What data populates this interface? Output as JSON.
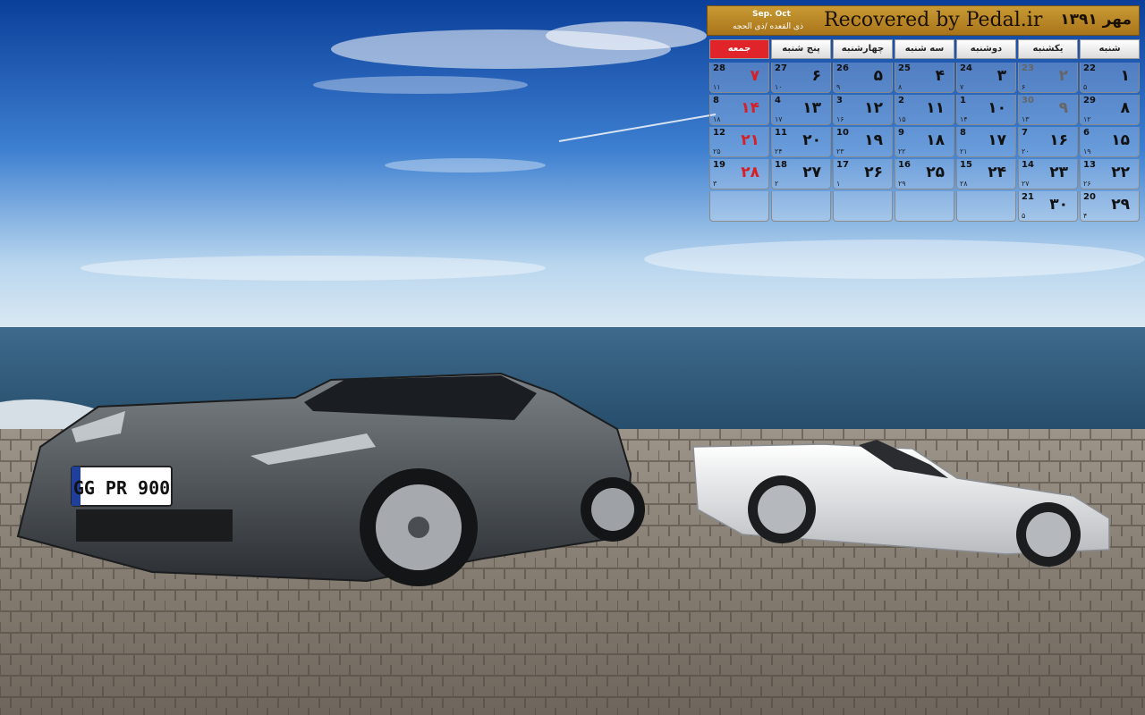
{
  "calendar": {
    "title": "Recovered by Pedal.ir",
    "month": "مهر ۱۳۹۱",
    "gregorian": "Sep. Oct",
    "hijri": "ذی القعده /ذی الحجه",
    "weekdays": [
      "شنبه",
      "یکشنبه",
      "دوشنبه",
      "سه شنبه",
      "چهارشنبه",
      "پنج شنبه",
      "جمعه"
    ],
    "weeks": [
      [
        {
          "g": "22",
          "h": "۵",
          "p": "۱"
        },
        {
          "g": "23",
          "h": "۶",
          "p": "۲"
        },
        {
          "g": "24",
          "h": "۷",
          "p": "۳"
        },
        {
          "g": "25",
          "h": "۸",
          "p": "۴"
        },
        {
          "g": "26",
          "h": "۹",
          "p": "۵"
        },
        {
          "g": "27",
          "h": "۱۰",
          "p": "۶"
        },
        {
          "g": "28",
          "h": "۱۱",
          "p": "۷"
        }
      ],
      [
        {
          "g": "29",
          "h": "۱۲",
          "p": "۸"
        },
        {
          "g": "30",
          "h": "۱۳",
          "p": "۹"
        },
        {
          "g": "1",
          "h": "۱۴",
          "p": "۱۰"
        },
        {
          "g": "2",
          "h": "۱۵",
          "p": "۱۱"
        },
        {
          "g": "3",
          "h": "۱۶",
          "p": "۱۲"
        },
        {
          "g": "4",
          "h": "۱۷",
          "p": "۱۳"
        },
        {
          "g": "8",
          "h": "۱۸",
          "p": "۱۴"
        }
      ],
      [
        {
          "g": "6",
          "h": "۱۹",
          "p": "۱۵"
        },
        {
          "g": "7",
          "h": "۲۰",
          "p": "۱۶"
        },
        {
          "g": "8",
          "h": "۲۱",
          "p": "۱۷"
        },
        {
          "g": "9",
          "h": "۲۲",
          "p": "۱۸"
        },
        {
          "g": "10",
          "h": "۲۳",
          "p": "۱۹"
        },
        {
          "g": "11",
          "h": "۲۴",
          "p": "۲۰"
        },
        {
          "g": "12",
          "h": "۲۵",
          "p": "۲۱"
        }
      ],
      [
        {
          "g": "13",
          "h": "۲۶",
          "p": "۲۲"
        },
        {
          "g": "14",
          "h": "۲۷",
          "p": "۲۳"
        },
        {
          "g": "15",
          "h": "۲۸",
          "p": "۲۴"
        },
        {
          "g": "16",
          "h": "۲۹",
          "p": "۲۵"
        },
        {
          "g": "17",
          "h": "۱",
          "p": "۲۶"
        },
        {
          "g": "18",
          "h": "۲",
          "p": "۲۷"
        },
        {
          "g": "19",
          "h": "۳",
          "p": "۲۸"
        }
      ],
      [
        {
          "g": "20",
          "h": "۴",
          "p": "۲۹"
        },
        {
          "g": "21",
          "h": "۵",
          "p": "۳۰"
        },
        {
          "g": "",
          "h": "",
          "p": ""
        },
        {
          "g": "",
          "h": "",
          "p": ""
        },
        {
          "g": "",
          "h": "",
          "p": ""
        },
        {
          "g": "",
          "h": "",
          "p": ""
        },
        {
          "g": "",
          "h": "",
          "p": ""
        }
      ]
    ]
  },
  "license_plate": "GG PR 900",
  "colors": {
    "accent_header": "#b8862a",
    "friday_red": "#e0242a",
    "sky": "#1f5fb0",
    "sea": "#2e5a7a"
  }
}
